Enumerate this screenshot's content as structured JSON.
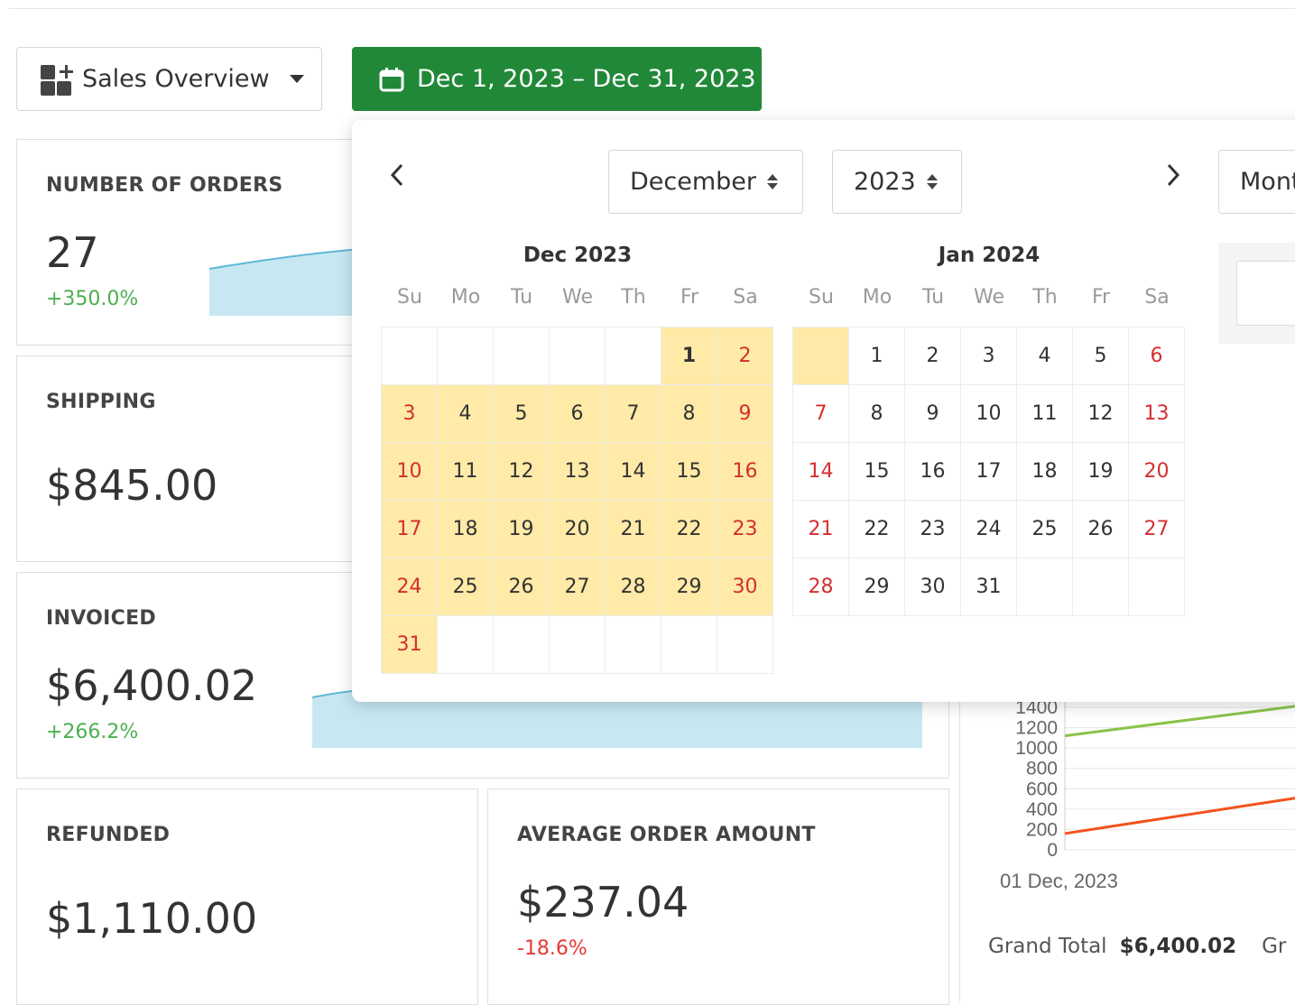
{
  "toolbar": {
    "dashboard_label": "Sales Overview",
    "date_range": "Dec 1, 2023 – Dec 31, 2023"
  },
  "cards": {
    "orders": {
      "label": "NUMBER OF ORDERS",
      "value": "27",
      "delta": "+350.0%"
    },
    "shipping": {
      "label": "SHIPPING",
      "value": "$845.00"
    },
    "invoiced": {
      "label": "INVOICED",
      "value": "$6,400.02",
      "delta": "+266.2%"
    },
    "refunded": {
      "label": "REFUNDED",
      "value": "$1,110.00"
    },
    "avg_order": {
      "label": "AVERAGE ORDER AMOUNT",
      "value": "$237.04",
      "delta": "-18.6%"
    }
  },
  "chart_data": {
    "type": "line",
    "x": [
      "01 Dec, 2023"
    ],
    "y_ticks": [
      "0",
      "200",
      "400",
      "600",
      "800",
      "1000",
      "1200",
      "1400"
    ],
    "series": [
      {
        "color": "#8bc34a",
        "values": [
          1120,
          1420
        ]
      },
      {
        "color": "#f4511e",
        "values": [
          160,
          520
        ]
      }
    ],
    "ylim": [
      0,
      1400
    ],
    "grid": true
  },
  "totals": {
    "grand_total_label": "Grand Total",
    "grand_total_value": "$6,400.02",
    "next_label_partial": "Gr"
  },
  "picker": {
    "month_select": "December",
    "year_select": "2023",
    "mode_select_partial": "Mont",
    "weekdays": [
      "Su",
      "Mo",
      "Tu",
      "We",
      "Th",
      "Fr",
      "Sa"
    ],
    "months": [
      {
        "title": "Dec 2023",
        "days": [
          "",
          "",
          "",
          "",
          "",
          "1",
          "2",
          "3",
          "4",
          "5",
          "6",
          "7",
          "8",
          "9",
          "10",
          "11",
          "12",
          "13",
          "14",
          "15",
          "16",
          "17",
          "18",
          "19",
          "20",
          "21",
          "22",
          "23",
          "24",
          "25",
          "26",
          "27",
          "28",
          "29",
          "30",
          "31",
          "",
          "",
          "",
          "",
          "",
          ""
        ],
        "selected_from": 5,
        "selected_to": 35
      },
      {
        "title": "Jan 2024",
        "days": [
          "",
          "1",
          "2",
          "3",
          "4",
          "5",
          "6",
          "7",
          "8",
          "9",
          "10",
          "11",
          "12",
          "13",
          "14",
          "15",
          "16",
          "17",
          "18",
          "19",
          "20",
          "21",
          "22",
          "23",
          "24",
          "25",
          "26",
          "27",
          "28",
          "29",
          "30",
          "31",
          "",
          "",
          ""
        ],
        "selected_from": 0,
        "selected_to": 0
      }
    ]
  },
  "colors": {
    "accent_green": "#218838",
    "range_fill": "#ffeaa7",
    "weekend_red": "#d32f2f",
    "positive": "#4caf50",
    "negative": "#e53935"
  }
}
